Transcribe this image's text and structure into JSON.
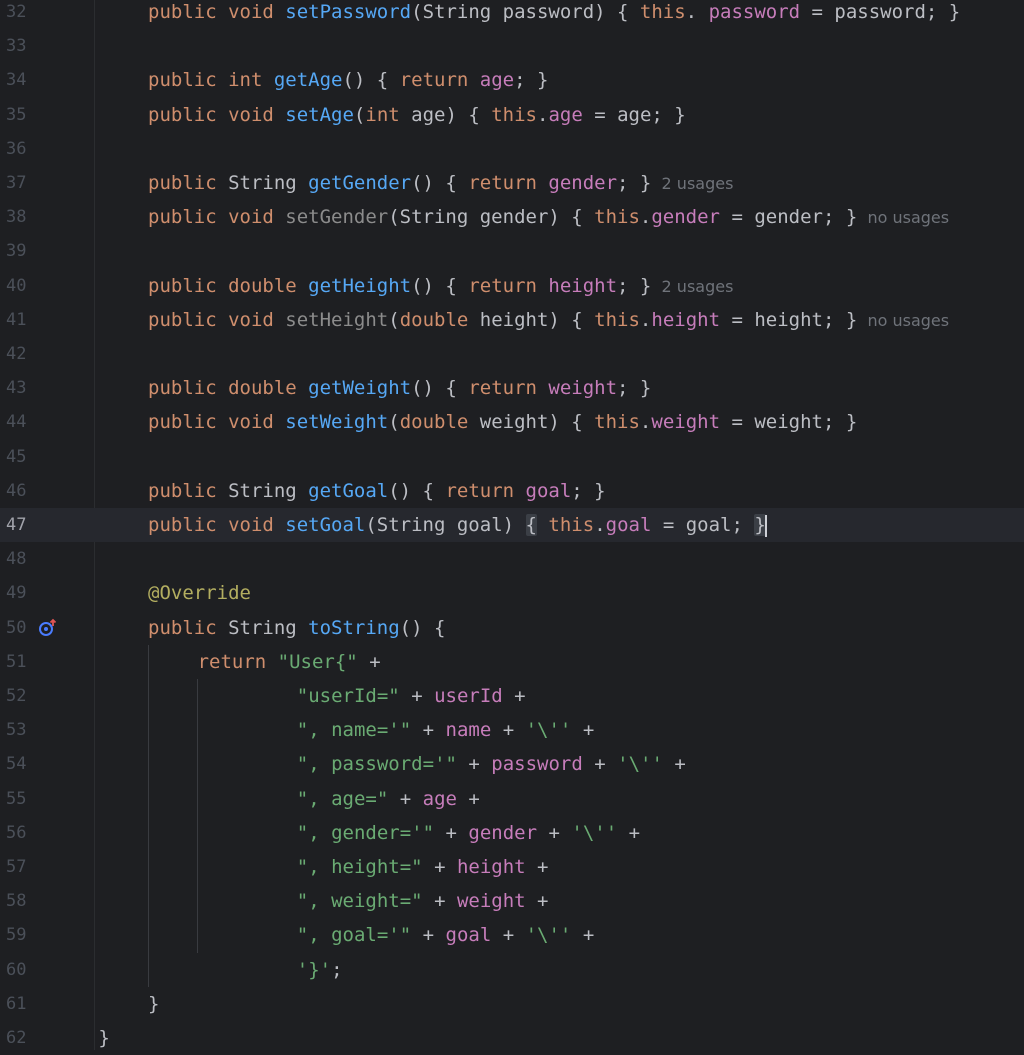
{
  "editor": {
    "lines": [
      {
        "n": "32",
        "parts": [
          [
            "kw",
            "public void "
          ],
          [
            "fn",
            "setPassword"
          ],
          [
            "",
            "(String password) { "
          ],
          [
            "kw",
            "this"
          ],
          [
            "",
            ". "
          ],
          [
            "fld",
            "password"
          ],
          [
            "",
            " = password; }"
          ]
        ]
      },
      {
        "n": "33",
        "parts": []
      },
      {
        "n": "34",
        "parts": [
          [
            "kw",
            "public int "
          ],
          [
            "fn",
            "getAge"
          ],
          [
            "",
            "() { "
          ],
          [
            "kw",
            "return "
          ],
          [
            "fld",
            "age"
          ],
          [
            "",
            "; }"
          ]
        ]
      },
      {
        "n": "35",
        "parts": [
          [
            "kw",
            "public void "
          ],
          [
            "fn",
            "setAge"
          ],
          [
            "",
            "("
          ],
          [
            "kw",
            "int "
          ],
          [
            "",
            "age) { "
          ],
          [
            "kw",
            "this"
          ],
          [
            "",
            "."
          ],
          [
            "fld",
            "age"
          ],
          [
            "",
            " = age; }"
          ]
        ]
      },
      {
        "n": "36",
        "parts": []
      },
      {
        "n": "37",
        "parts": [
          [
            "kw",
            "public "
          ],
          [
            "",
            "String "
          ],
          [
            "fn",
            "getGender"
          ],
          [
            "",
            "() { "
          ],
          [
            "kw",
            "return "
          ],
          [
            "fld",
            "gender"
          ],
          [
            "",
            "; }"
          ]
        ],
        "hint": "2 usages"
      },
      {
        "n": "38",
        "parts": [
          [
            "kw",
            "public void "
          ],
          [
            "fn-unused",
            "setGender"
          ],
          [
            "",
            "(String gender) { "
          ],
          [
            "kw",
            "this"
          ],
          [
            "",
            "."
          ],
          [
            "fld",
            "gender"
          ],
          [
            "",
            " = gender; }"
          ]
        ],
        "hint": "no usages"
      },
      {
        "n": "39",
        "parts": []
      },
      {
        "n": "40",
        "parts": [
          [
            "kw",
            "public double "
          ],
          [
            "fn",
            "getHeight"
          ],
          [
            "",
            "() { "
          ],
          [
            "kw",
            "return "
          ],
          [
            "fld",
            "height"
          ],
          [
            "",
            "; }"
          ]
        ],
        "hint": "2 usages"
      },
      {
        "n": "41",
        "parts": [
          [
            "kw",
            "public void "
          ],
          [
            "fn-unused",
            "setHeight"
          ],
          [
            "",
            "("
          ],
          [
            "kw",
            "double "
          ],
          [
            "",
            "height) { "
          ],
          [
            "kw",
            "this"
          ],
          [
            "",
            "."
          ],
          [
            "fld",
            "height"
          ],
          [
            "",
            " = height; }"
          ]
        ],
        "hint": "no usages"
      },
      {
        "n": "42",
        "parts": []
      },
      {
        "n": "43",
        "parts": [
          [
            "kw",
            "public double "
          ],
          [
            "fn",
            "getWeight"
          ],
          [
            "",
            "() { "
          ],
          [
            "kw",
            "return "
          ],
          [
            "fld",
            "weight"
          ],
          [
            "",
            "; }"
          ]
        ]
      },
      {
        "n": "44",
        "parts": [
          [
            "kw",
            "public void "
          ],
          [
            "fn",
            "setWeight"
          ],
          [
            "",
            "("
          ],
          [
            "kw",
            "double "
          ],
          [
            "",
            "weight) { "
          ],
          [
            "kw",
            "this"
          ],
          [
            "",
            "."
          ],
          [
            "fld",
            "weight"
          ],
          [
            "",
            " = weight; }"
          ]
        ]
      },
      {
        "n": "45",
        "parts": []
      },
      {
        "n": "46",
        "parts": [
          [
            "kw",
            "public "
          ],
          [
            "",
            "String "
          ],
          [
            "fn",
            "getGoal"
          ],
          [
            "",
            "() { "
          ],
          [
            "kw",
            "return "
          ],
          [
            "fld",
            "goal"
          ],
          [
            "",
            "; }"
          ]
        ]
      },
      {
        "n": "47",
        "parts": [
          [
            "kw",
            "public void "
          ],
          [
            "fn",
            "setGoal"
          ],
          [
            "",
            "(String goal) "
          ],
          [
            "brace-hl",
            "{"
          ],
          [
            "",
            " "
          ],
          [
            "kw",
            "this"
          ],
          [
            "",
            "."
          ],
          [
            "fld",
            "goal"
          ],
          [
            "",
            " = goal; "
          ],
          [
            "brace-hl",
            "}"
          ]
        ],
        "current": true
      },
      {
        "n": "48",
        "parts": []
      },
      {
        "n": "49",
        "parts": [
          [
            "ann",
            "@Override"
          ]
        ]
      },
      {
        "n": "50",
        "parts": [
          [
            "kw",
            "public "
          ],
          [
            "",
            "String "
          ],
          [
            "fn",
            "toString"
          ],
          [
            "",
            "() {"
          ]
        ],
        "gutter_icon": "override-method-icon"
      },
      {
        "n": "51",
        "indent": 2,
        "parts": [
          [
            "kw",
            "return "
          ],
          [
            "str",
            "\"User{\""
          ],
          [
            "",
            " +"
          ]
        ]
      },
      {
        "n": "52",
        "indent": 6,
        "parts": [
          [
            "str",
            "\"userId=\""
          ],
          [
            "",
            " + "
          ],
          [
            "fld",
            "userId"
          ],
          [
            "",
            " +"
          ]
        ]
      },
      {
        "n": "53",
        "indent": 6,
        "parts": [
          [
            "str",
            "\", name='\""
          ],
          [
            "",
            " + "
          ],
          [
            "fld",
            "name"
          ],
          [
            "",
            " + "
          ],
          [
            "str",
            "'\\''"
          ],
          [
            "",
            " +"
          ]
        ]
      },
      {
        "n": "54",
        "indent": 6,
        "parts": [
          [
            "str",
            "\", password='\""
          ],
          [
            "",
            " + "
          ],
          [
            "fld",
            "password"
          ],
          [
            "",
            " + "
          ],
          [
            "str",
            "'\\''"
          ],
          [
            "",
            " +"
          ]
        ]
      },
      {
        "n": "55",
        "indent": 6,
        "parts": [
          [
            "str",
            "\", age=\""
          ],
          [
            "",
            " + "
          ],
          [
            "fld",
            "age"
          ],
          [
            "",
            " +"
          ]
        ]
      },
      {
        "n": "56",
        "indent": 6,
        "parts": [
          [
            "str",
            "\", gender='\""
          ],
          [
            "",
            " + "
          ],
          [
            "fld",
            "gender"
          ],
          [
            "",
            " + "
          ],
          [
            "str",
            "'\\''"
          ],
          [
            "",
            " +"
          ]
        ]
      },
      {
        "n": "57",
        "indent": 6,
        "parts": [
          [
            "str",
            "\", height=\""
          ],
          [
            "",
            " + "
          ],
          [
            "fld",
            "height"
          ],
          [
            "",
            " +"
          ]
        ]
      },
      {
        "n": "58",
        "indent": 6,
        "parts": [
          [
            "str",
            "\", weight=\""
          ],
          [
            "",
            " + "
          ],
          [
            "fld",
            "weight"
          ],
          [
            "",
            " +"
          ]
        ]
      },
      {
        "n": "59",
        "indent": 6,
        "parts": [
          [
            "str",
            "\", goal='\""
          ],
          [
            "",
            " + "
          ],
          [
            "fld",
            "goal"
          ],
          [
            "",
            " + "
          ],
          [
            "str",
            "'\\''"
          ],
          [
            "",
            " +"
          ]
        ]
      },
      {
        "n": "60",
        "indent": 6,
        "parts": [
          [
            "str",
            "'}'"
          ],
          [
            "",
            ";"
          ]
        ]
      },
      {
        "n": "61",
        "parts": [
          [
            "",
            "}"
          ]
        ]
      },
      {
        "n": "62",
        "indent": -2,
        "parts": [
          [
            "",
            "}"
          ]
        ]
      }
    ]
  },
  "colors": {
    "background": "#1e1f22",
    "keyword": "#cf8e6d",
    "method": "#56a8f5",
    "field": "#c77dbb",
    "string": "#6aab73",
    "annotation": "#b3ae60"
  }
}
